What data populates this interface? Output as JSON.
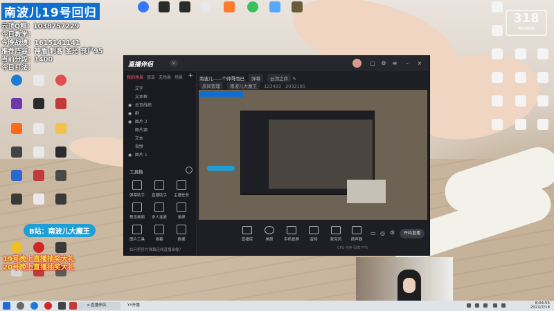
{
  "overlay": {
    "title": "南波儿19号回归",
    "lines": [
      "云顶Q群：1038757229",
      "今日教学：",
      "今晚战绩：1615141141",
      "推荐阵容：神盾 刺客 圣光 丧尸95",
      "当前分段：1400",
      "今日打法："
    ],
    "bilibili": "B站：南波儿大魔王",
    "banner_1": "19号晚上直播抽奖大礼",
    "banner_2": "20号晚上直播抽奖大礼",
    "watermark": "318",
    "watermark_sub": "ROUND"
  },
  "desktop_icons": [
    {
      "label": "",
      "color": "#6a6ad8"
    },
    {
      "label": "",
      "color": "#ffd24a"
    },
    {
      "label": "",
      "color": "#3a9bd9"
    },
    {
      "label": "",
      "color": "#e06030"
    },
    {
      "label": "",
      "color": "#7a7a7a"
    },
    {
      "label": "",
      "color": "#4ab84a"
    },
    {
      "label": "",
      "color": "#ff9a30"
    },
    {
      "label": "",
      "color": "#e24e4e"
    }
  ],
  "top_icons": [
    {
      "color": "#3478f6"
    },
    {
      "color": "#2b2b2b"
    },
    {
      "color": "#2b2b2b"
    },
    {
      "color": "#e8e8e8"
    },
    {
      "color": "#ff7a2a"
    },
    {
      "color": "#3bc15a"
    },
    {
      "color": "#56a8ff"
    },
    {
      "color": "#6b5b3a"
    }
  ],
  "app": {
    "logo": "直播伴侣",
    "version": "v",
    "tabs": [
      "我的场景",
      "双击",
      "无场景",
      "场景"
    ],
    "scenes": [
      "文字",
      "文本框",
      "云顶战绩",
      "群",
      "图片 2",
      "图片源",
      "文本",
      "视频",
      "图片 1",
      "图片"
    ],
    "tools_header": "工具箱",
    "tools": [
      "弹幕助手",
      "直播助手",
      "主播任务",
      "预览画面",
      "多人连麦",
      "录屏",
      "图片工具",
      "弹幕",
      "数据",
      "",
      "",
      ""
    ],
    "notice": "如何把官方弹幕连线直播录像？",
    "stream_title": "南波儿——个帅哥而已",
    "stream_chip_1": "弹幕",
    "stream_chip_2": "云顶之弈",
    "room_chip_1": "房间管理",
    "room_chip_2": "南波儿大魔王",
    "room_num_1": "123433",
    "room_num_2": "2032195",
    "bottom_buttons": [
      "直播库",
      "美颜",
      "手机投屏",
      "音频",
      "麦克风",
      "扬声器"
    ],
    "start_label": "开始直播",
    "stats": "CPU  内存  码率  FPS"
  },
  "taskbar": {
    "apps": [
      "e.直播伴侣",
      "YY开播"
    ],
    "time": "8:04:55",
    "date": "2021/7/18"
  }
}
